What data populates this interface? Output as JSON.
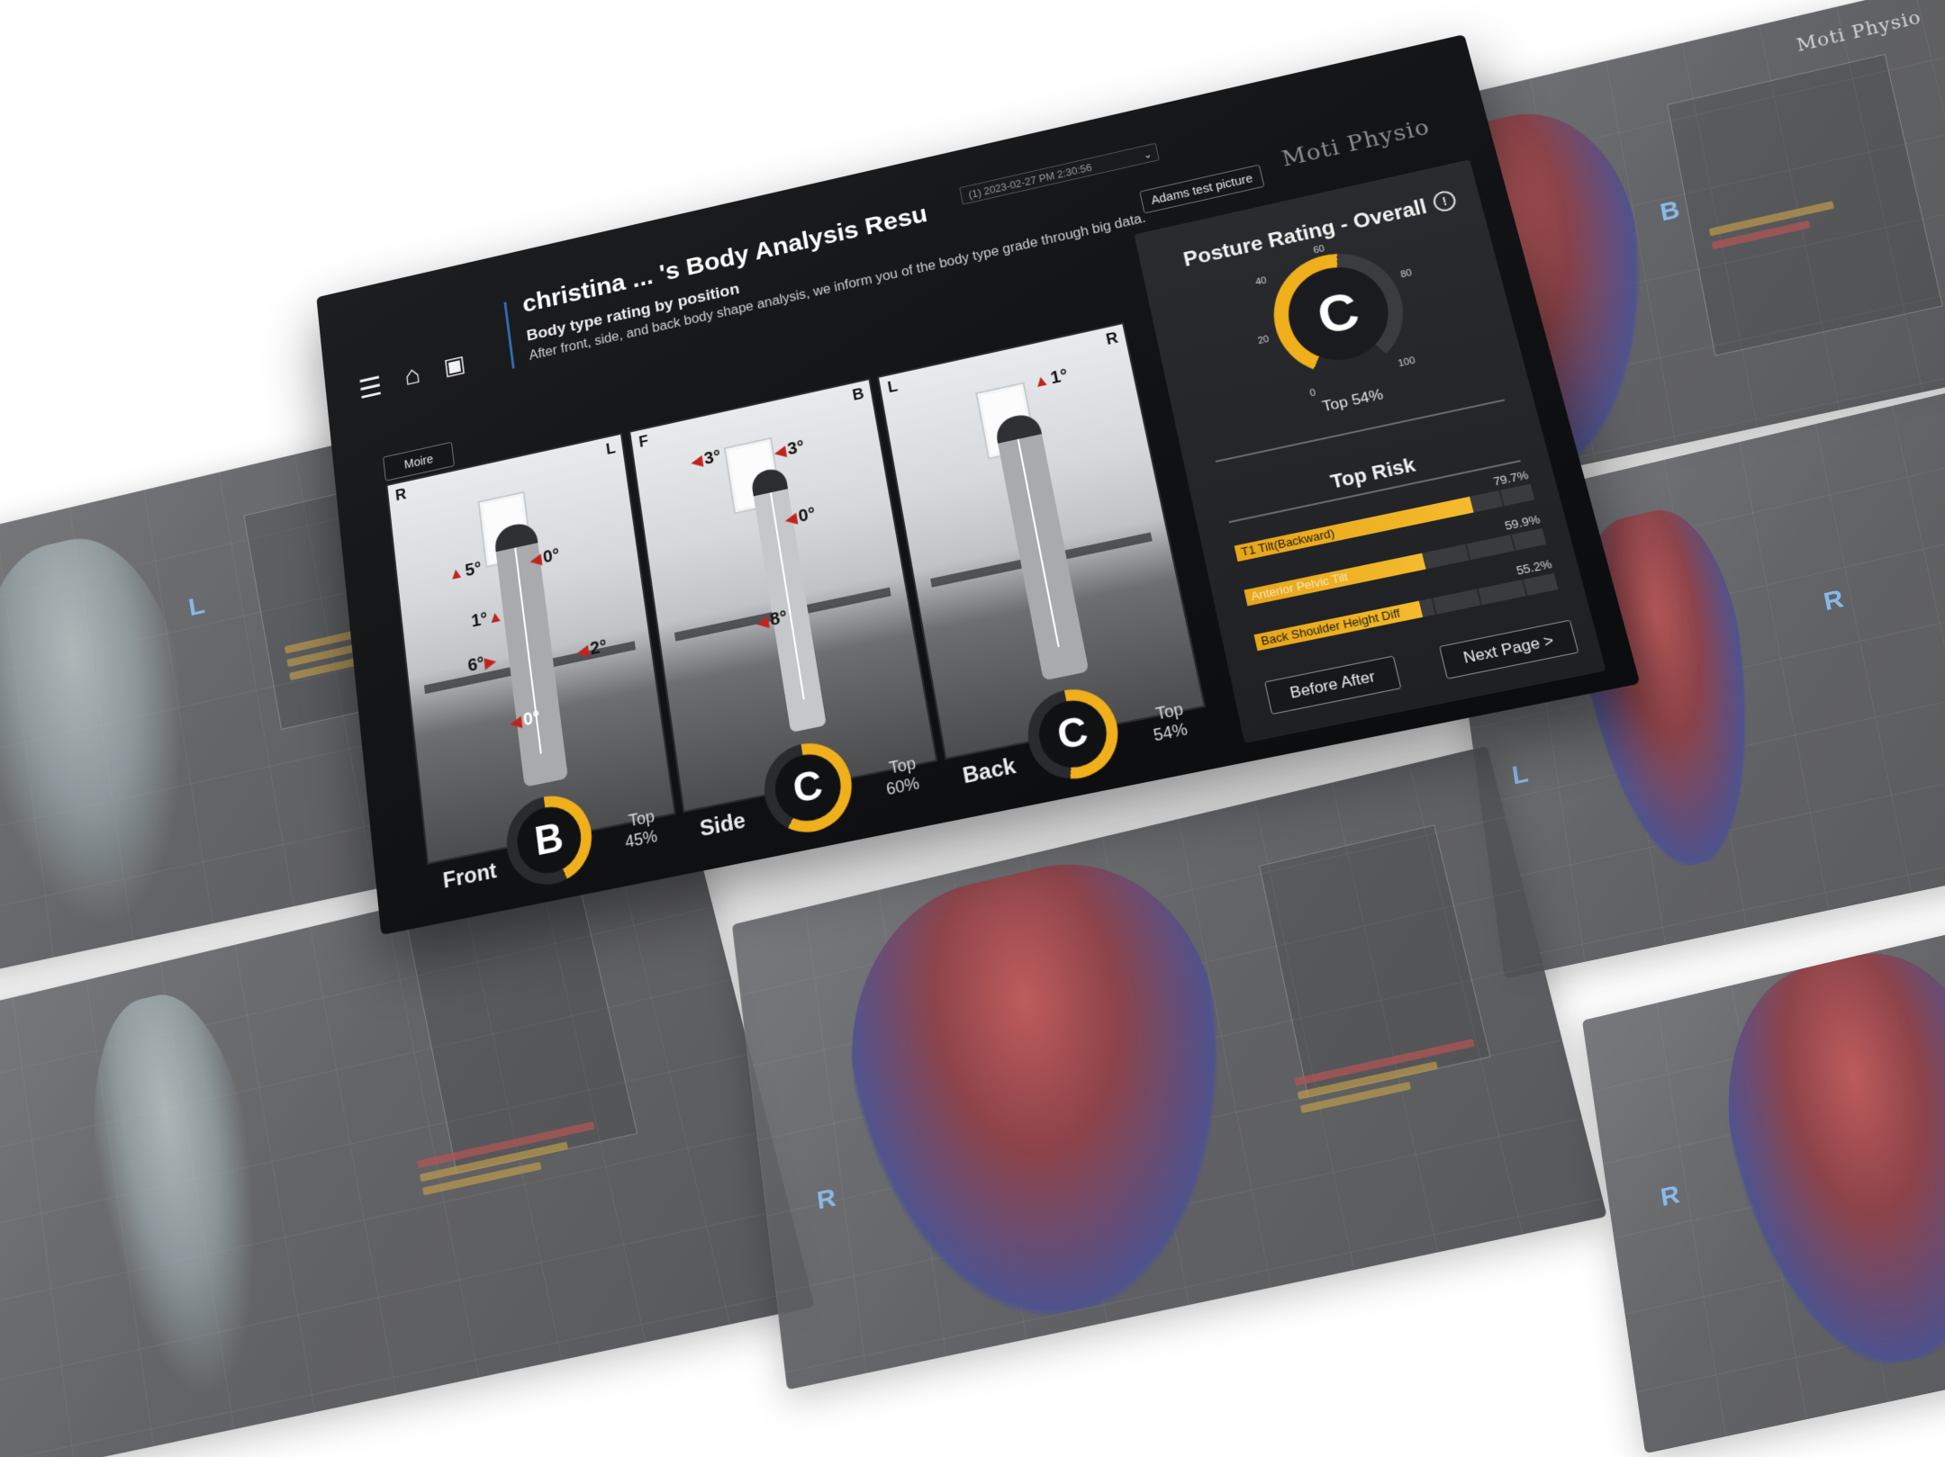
{
  "brand": "Moti Physio",
  "header": {
    "title": "christina ... 's Body Analysis Resu",
    "date_select": "(1) 2023-02-27 PM 2:30:56",
    "subtitle": "Body type rating by position",
    "description": "After front, side, and back body shape analysis, we inform you of the body type grade through big data.",
    "adams_button": "Adams test picture",
    "moire_button": "Moire"
  },
  "photos": [
    {
      "view": "Front",
      "left_marker": "R",
      "right_marker": "L",
      "angles": [
        "5°",
        "0°",
        "1°",
        "6°",
        "2°",
        "0°"
      ],
      "grade": "B",
      "top_label": "Top",
      "top_pct": "45%",
      "grade_fraction": 0.45
    },
    {
      "view": "Side",
      "left_marker": "F",
      "right_marker": "B",
      "angles": [
        "3°",
        "3°",
        "0°",
        "8°"
      ],
      "grade": "C",
      "top_label": "Top",
      "top_pct": "60%",
      "grade_fraction": 0.6
    },
    {
      "view": "Back",
      "left_marker": "L",
      "right_marker": "R",
      "angles": [
        "1°"
      ],
      "grade": "C",
      "top_label": "Top",
      "top_pct": "54%",
      "grade_fraction": 0.54
    }
  ],
  "overall": {
    "title": "Posture Rating - Overall",
    "info_icon": "info-icon",
    "grade": "C",
    "ticks": [
      "0",
      "20",
      "40",
      "60",
      "80",
      "100"
    ],
    "top_text": "Top 54%",
    "value": 54
  },
  "top_risk": {
    "title": "Top Risk",
    "items": [
      {
        "label": "T1 Tilt(Backward)",
        "pct": "79.7%",
        "value": 79.7
      },
      {
        "label": "Anterior Pelvic Tilt",
        "pct": "59.9%",
        "value": 59.9
      },
      {
        "label": "Back Shoulder Height Diff",
        "pct": "55.2%",
        "value": 55.2
      }
    ]
  },
  "buttons": {
    "next_page": "Next Page >",
    "before_after": "Before After"
  },
  "background": {
    "brand_repeat": "Moti Physio",
    "letters": [
      "B",
      "L",
      "R",
      "L",
      "R",
      "R"
    ]
  },
  "colors": {
    "accent": "#f0b01c",
    "brand_blue": "#2e6fb3",
    "arrow_red": "#c0241c"
  }
}
